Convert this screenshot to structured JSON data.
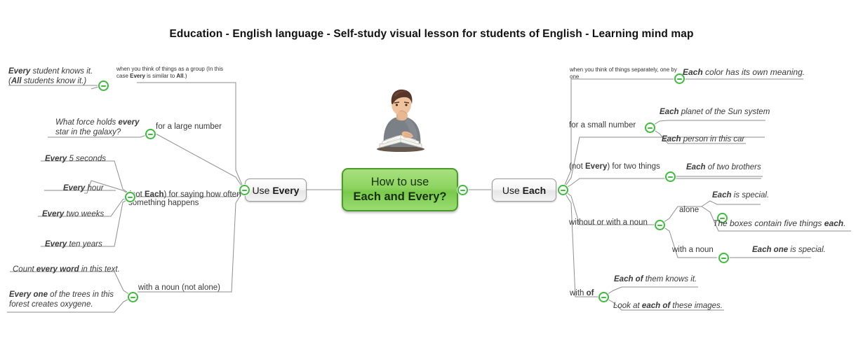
{
  "title": "Education - English language - Self-study visual lesson for students of English - Learning mind map",
  "root": {
    "line1": "How to use",
    "line2_a": "Each",
    "line2_mid": " and ",
    "line2_b": "Every",
    "line2_q": "?",
    "color": "#8ed45f",
    "border_color": "#4b9b2a"
  },
  "illustration": {
    "name": "student-reading-books-illustration"
  },
  "collapse_icon": {
    "name": "collapse-minus-icon",
    "color": "#3fbb3f"
  },
  "branches": [
    {
      "id": "use-every",
      "label_plain": "Use ",
      "label_bold": "Every",
      "side": "left",
      "children": [
        {
          "id": "think-as-group",
          "label": "when you think of things as a group (In this case Every is similar to All.)",
          "style": "tiny",
          "leaves": [
            {
              "text": "Every student knows it. (All students know it.)",
              "bold": [
                "Every",
                "All"
              ]
            }
          ]
        },
        {
          "id": "for-a-large-number",
          "label": "for a large number",
          "style": "mid",
          "leaves": [
            {
              "text": "What force holds every star in the galaxy?",
              "bold": [
                "every"
              ]
            }
          ]
        },
        {
          "id": "how-often-something-happens",
          "label": "(not Each) for saying how often something happens",
          "style": "mid",
          "leaves": [
            {
              "text": "Every 5 seconds",
              "bold": [
                "Every"
              ]
            },
            {
              "text": "Every hour",
              "bold": [
                "Every"
              ]
            },
            {
              "text": "Every two weeks",
              "bold": [
                "Every"
              ]
            },
            {
              "text": "Every ten years",
              "bold": [
                "Every"
              ]
            }
          ]
        },
        {
          "id": "with-a-noun-not-alone",
          "label": "with a noun (not alone)",
          "style": "mid",
          "leaves": [
            {
              "text": "Count every word in this text.",
              "bold": [
                "every word"
              ]
            },
            {
              "text": "Every one of the trees in this forest creates oxygene.",
              "bold": [
                "Every one"
              ]
            }
          ]
        }
      ]
    },
    {
      "id": "use-each",
      "label_plain": "Use ",
      "label_bold": "Each",
      "side": "right",
      "children": [
        {
          "id": "think-separately",
          "label": "when you think of things separately, one by one",
          "style": "tiny",
          "leaves": [
            {
              "text": "Each color has its own meaning.",
              "bold": [
                "Each"
              ]
            }
          ]
        },
        {
          "id": "for-a-small-number",
          "label": "for a small number",
          "style": "mid",
          "leaves": [
            {
              "text": "Each planet of the Sun system",
              "bold": [
                "Each"
              ]
            },
            {
              "text": "Each person in this car",
              "bold": [
                "Each"
              ]
            }
          ]
        },
        {
          "id": "for-two-things",
          "label": "(not Every) for two things",
          "style": "mid",
          "leaves": [
            {
              "text": "Each of two brothers",
              "bold": [
                "Each"
              ]
            }
          ]
        },
        {
          "id": "without-or-with-a-noun",
          "label": "without or with a noun",
          "style": "mid",
          "sublabels": [
            {
              "id": "alone",
              "label": "alone",
              "leaves": [
                {
                  "text": "Each is special.",
                  "bold": [
                    "Each"
                  ]
                },
                {
                  "text": "The boxes contain five things each.",
                  "bold": [
                    "each"
                  ]
                }
              ]
            },
            {
              "id": "with-a-noun",
              "label": "with a noun",
              "leaves": [
                {
                  "text": "Each one is special.",
                  "bold": [
                    "Each one"
                  ]
                }
              ]
            }
          ]
        },
        {
          "id": "with-of",
          "label": "with of",
          "label_bold": "of",
          "style": "mid",
          "leaves": [
            {
              "text": "Each of them knows it.",
              "bold": [
                "Each of"
              ]
            },
            {
              "text": "Look at each of these images.",
              "bold": [
                "each of"
              ]
            }
          ]
        }
      ]
    }
  ],
  "texts": {
    "L_every_student_1": "Every student knows it.",
    "L_every_student_2": "(All students know it.)",
    "L_group_note": "when you think of things as a group (In this case Every is similar to All.)",
    "L_large_number": "for a large number",
    "L_force_1": "What force holds every",
    "L_force_2": "star in the galaxy?",
    "L_5sec": "Every 5 seconds",
    "L_hour": "Every hour",
    "L_2weeks": "Every two weeks",
    "L_10years": "Every ten years",
    "L_howoften_1": "(not Each) for saying how often",
    "L_howoften_2": "something happens",
    "L_count_word": "Count every word in this text.",
    "L_trees_1": "Every one of the trees in this",
    "L_trees_2": "forest creates oxygene.",
    "L_with_noun_not_alone": "with a noun (not alone)",
    "R_separately_note": "when you think of things separately, one by one",
    "R_color": "Each color has its own meaning.",
    "R_small_number": "for a small number",
    "R_planet": "Each planet of the Sun system",
    "R_person": "Each person in this car",
    "R_two_things": "(not Every) for two things",
    "R_brothers": "Each of two brothers",
    "R_without_or_with": "without or with a noun",
    "R_alone": "alone",
    "R_each_special": "Each is special.",
    "R_boxes": "The boxes contain five things each.",
    "R_with_a_noun": "with a noun",
    "R_each_one_special": "Each one is special.",
    "R_with_of": "with of",
    "R_each_of_them": "Each of them knows it.",
    "R_look_at": "Look at each of these images."
  }
}
